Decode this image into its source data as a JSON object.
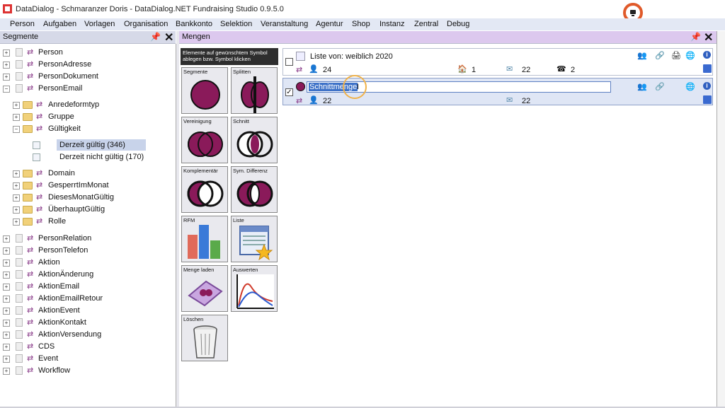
{
  "window": {
    "title": "DataDialog - Schmaranzer Doris - DataDialog.NET Fundraising Studio 0.9.5.0"
  },
  "menu": [
    "Person",
    "Aufgaben",
    "Vorlagen",
    "Organisation",
    "Bankkonto",
    "Selektion",
    "Veranstaltung",
    "Agentur",
    "Shop",
    "Instanz",
    "Zentral",
    "Debug"
  ],
  "left_panel": {
    "title": "Segmente",
    "tree": [
      {
        "label": "Person"
      },
      {
        "label": "PersonAdresse"
      },
      {
        "label": "PersonDokument"
      },
      {
        "label": "PersonEmail"
      },
      {
        "label": "Anredeformtyp"
      },
      {
        "label": "Gruppe"
      },
      {
        "label": "Gültigkeit"
      },
      {
        "label": "Derzeit gültig (346)"
      },
      {
        "label": "Derzeit nicht gültig (170)"
      },
      {
        "label": "Domain"
      },
      {
        "label": "GesperrtImMonat"
      },
      {
        "label": "DiesesMonatGültig"
      },
      {
        "label": "ÜberhauptGültig"
      },
      {
        "label": "Rolle"
      },
      {
        "label": "PersonRelation"
      },
      {
        "label": "PersonTelefon"
      },
      {
        "label": "Aktion"
      },
      {
        "label": "AktionÄnderung"
      },
      {
        "label": "AktionEmail"
      },
      {
        "label": "AktionEmailRetour"
      },
      {
        "label": "AktionEvent"
      },
      {
        "label": "AktionKontakt"
      },
      {
        "label": "AktionVersendung"
      },
      {
        "label": "CDS"
      },
      {
        "label": "Event"
      },
      {
        "label": "Workflow"
      }
    ]
  },
  "mengen_panel": {
    "title": "Mengen",
    "hint": "Elemente auf gewünschtem Symbol ablegen bzw. Symbol klicken",
    "tools": [
      {
        "label": "Segmente"
      },
      {
        "label": "Splitten"
      },
      {
        "label": "Vereinigung"
      },
      {
        "label": "Schnitt"
      },
      {
        "label": "Komplementär"
      },
      {
        "label": "Sym. Differenz"
      },
      {
        "label": "RFM"
      },
      {
        "label": "Liste"
      },
      {
        "label": "Menge laden"
      },
      {
        "label": "Auswerten"
      },
      {
        "label": "Löschen"
      }
    ],
    "sets": [
      {
        "name": "Liste von: weiblich 2020",
        "persons": "24",
        "addresses": "1",
        "emails": "22",
        "phones": "2",
        "checked": false
      },
      {
        "name": "Schnittmenge",
        "persons": "22",
        "emails": "22",
        "checked": true
      }
    ]
  },
  "icons": {
    "pin": "pin-icon",
    "close": "close-icon",
    "expand": "plus-icon",
    "collapse": "minus-icon",
    "record": "screen-record-icon",
    "info": "info-icon",
    "save": "save-icon"
  },
  "colors": {
    "menubar": "#e3e8f4",
    "mengen_header": "#dcc8ee",
    "venn": "#8a1a5a",
    "selection": "#3e72c8",
    "highlight": "#f0b24a",
    "record_ring": "#e05a2a"
  }
}
